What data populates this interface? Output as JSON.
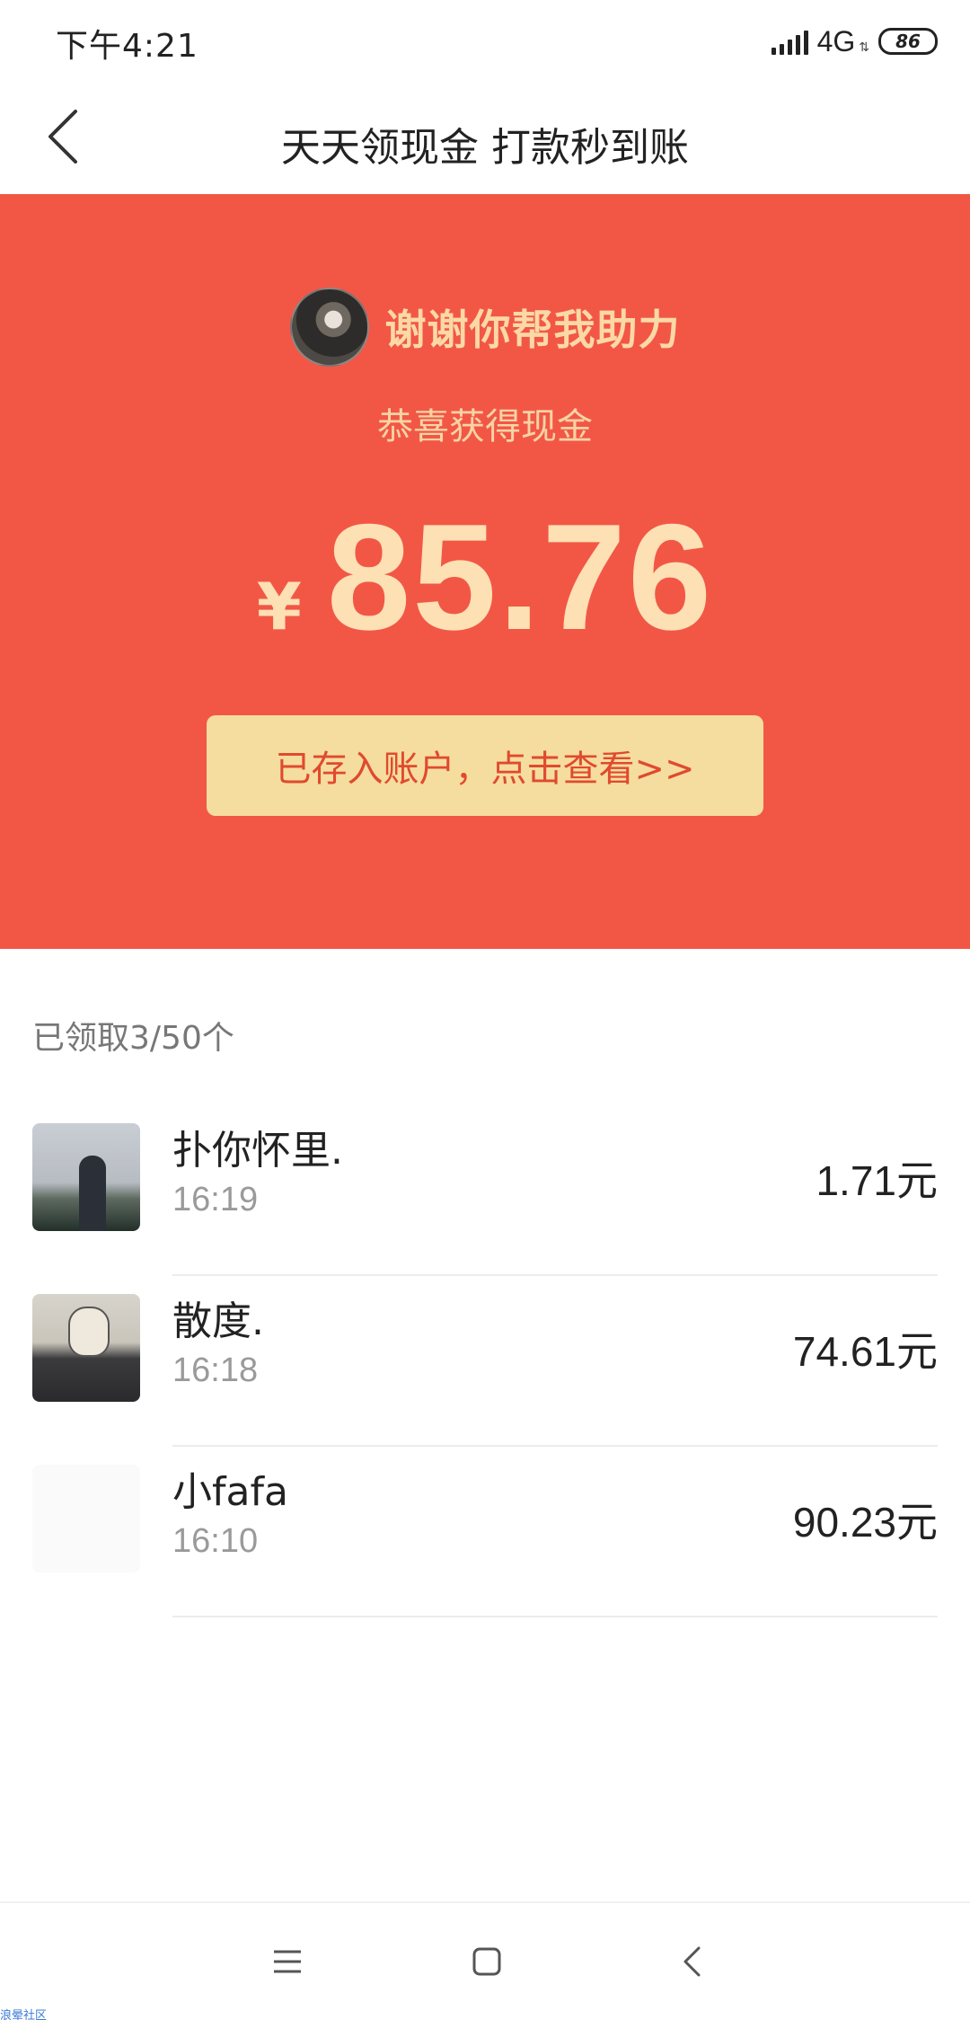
{
  "status_bar": {
    "time": "下午4:21",
    "network": "4G",
    "battery": "86"
  },
  "nav": {
    "title": "天天领现金 打款秒到账",
    "back_icon": "chevron-left-icon"
  },
  "hero": {
    "thanks_text": "谢谢你帮我助力",
    "subtitle": "恭喜获得现金",
    "currency_symbol": "¥",
    "amount": "85.76",
    "cta_label": "已存入账户，点击查看>>",
    "colors": {
      "background": "#f25746",
      "text": "#fde0b3",
      "button": "#f5dd9f",
      "button_text": "#e04a2f"
    }
  },
  "claimed": {
    "summary": "已领取3/50个",
    "items": [
      {
        "name": "扑你怀里.",
        "time": "16:19",
        "amount": "1.71元"
      },
      {
        "name": "散度.",
        "time": "16:18",
        "amount": "74.61元"
      },
      {
        "name": "小fafa",
        "time": "16:10",
        "amount": "90.23元"
      }
    ]
  },
  "system_nav": {
    "menu_icon": "menu-icon",
    "home_icon": "home-square-icon",
    "back_icon": "back-chevron-icon"
  },
  "watermark": "浪晕社区"
}
